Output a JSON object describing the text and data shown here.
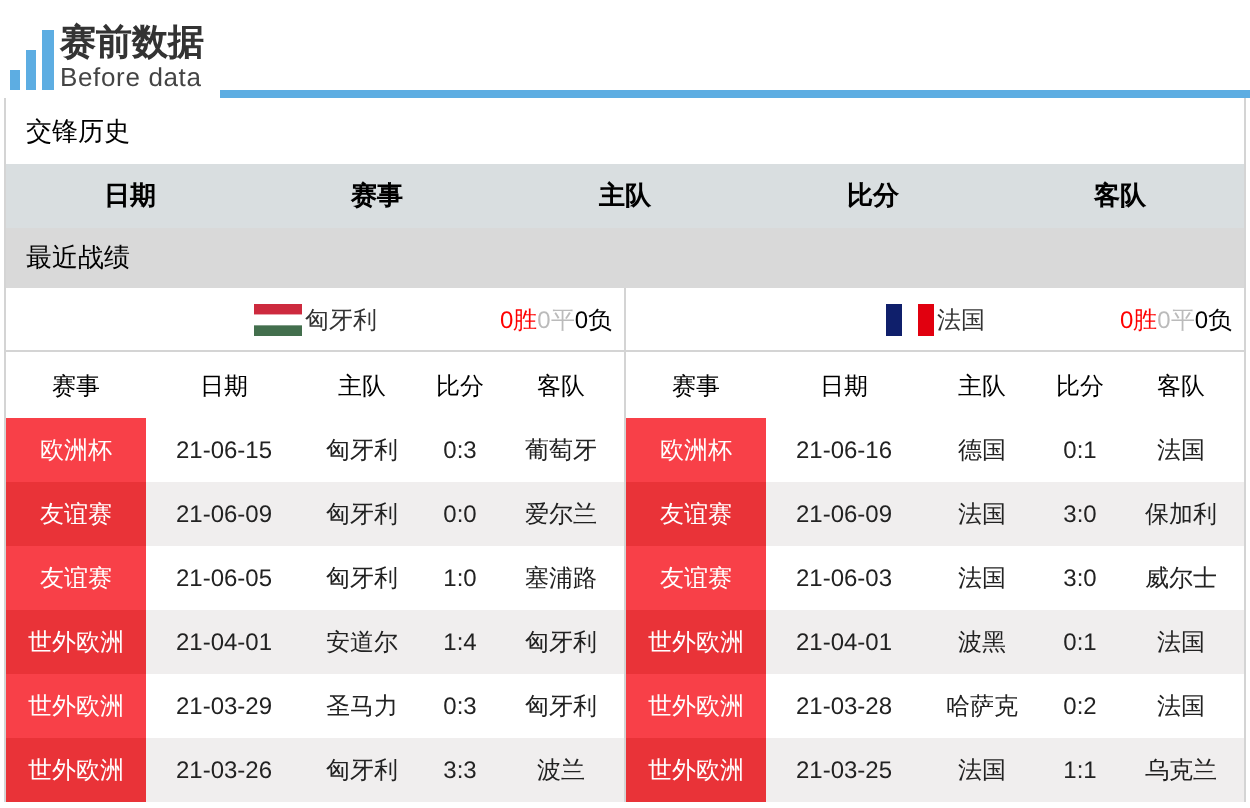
{
  "header": {
    "title": "赛前数据",
    "subtitle": "Before data"
  },
  "h2h": {
    "title": "交锋历史",
    "columns": [
      "日期",
      "赛事",
      "主队",
      "比分",
      "客队"
    ]
  },
  "recent": {
    "title": "最近战绩"
  },
  "teams": [
    {
      "name": "匈牙利",
      "kind": "hungary",
      "wins": "0胜",
      "draws": "0平",
      "losses": "0负",
      "columns": [
        "赛事",
        "日期",
        "主队",
        "比分",
        "客队"
      ],
      "rows": [
        {
          "competition": "欧洲杯",
          "date": "21-06-15",
          "home": "匈牙利",
          "score": "0:3",
          "away": "葡萄牙"
        },
        {
          "competition": "友谊赛",
          "date": "21-06-09",
          "home": "匈牙利",
          "score": "0:0",
          "away": "爱尔兰"
        },
        {
          "competition": "友谊赛",
          "date": "21-06-05",
          "home": "匈牙利",
          "score": "1:0",
          "away": "塞浦路"
        },
        {
          "competition": "世外欧洲",
          "date": "21-04-01",
          "home": "安道尔",
          "score": "1:4",
          "away": "匈牙利"
        },
        {
          "competition": "世外欧洲",
          "date": "21-03-29",
          "home": "圣马力",
          "score": "0:3",
          "away": "匈牙利"
        },
        {
          "competition": "世外欧洲",
          "date": "21-03-26",
          "home": "匈牙利",
          "score": "3:3",
          "away": "波兰"
        }
      ]
    },
    {
      "name": "法国",
      "kind": "france",
      "wins": "0胜",
      "draws": "0平",
      "losses": "0负",
      "columns": [
        "赛事",
        "日期",
        "主队",
        "比分",
        "客队"
      ],
      "rows": [
        {
          "competition": "欧洲杯",
          "date": "21-06-16",
          "home": "德国",
          "score": "0:1",
          "away": "法国"
        },
        {
          "competition": "友谊赛",
          "date": "21-06-09",
          "home": "法国",
          "score": "3:0",
          "away": "保加利"
        },
        {
          "competition": "友谊赛",
          "date": "21-06-03",
          "home": "法国",
          "score": "3:0",
          "away": "威尔士"
        },
        {
          "competition": "世外欧洲",
          "date": "21-04-01",
          "home": "波黑",
          "score": "0:1",
          "away": "法国"
        },
        {
          "competition": "世外欧洲",
          "date": "21-03-28",
          "home": "哈萨克",
          "score": "0:2",
          "away": "法国"
        },
        {
          "competition": "世外欧洲",
          "date": "21-03-25",
          "home": "法国",
          "score": "1:1",
          "away": "乌克兰"
        }
      ]
    }
  ]
}
